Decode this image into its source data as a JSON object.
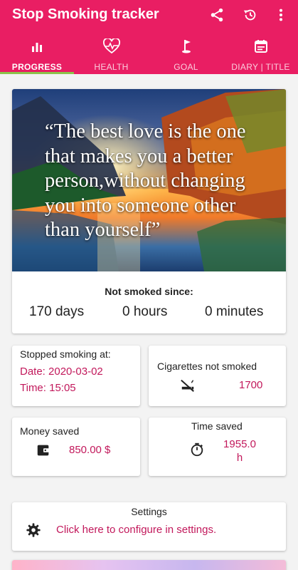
{
  "app": {
    "title": "Stop Smoking tracker"
  },
  "actions": {
    "share_icon": "share-icon",
    "restore_icon": "restore-icon",
    "more_icon": "more-vert-icon"
  },
  "tabs": [
    {
      "label": "PROGRESS",
      "icon": "bar-chart-icon",
      "active": true
    },
    {
      "label": "HEALTH",
      "icon": "heart-pulse-icon",
      "active": false
    },
    {
      "label": "GOAL",
      "icon": "golf-flag-icon",
      "active": false
    },
    {
      "label": "DIARY | TITLE",
      "icon": "calendar-icon",
      "active": false
    }
  ],
  "quote": {
    "lines": [
      "“The best love is the one",
      "that makes you a better",
      "person,without changing",
      "you into someone other",
      "than yourself”"
    ]
  },
  "not_smoked": {
    "title": "Not smoked since:",
    "days": "170 days",
    "hours": "0 hours",
    "minutes": "0 minutes"
  },
  "stopped": {
    "title": "Stopped smoking at:",
    "date": "Date: 2020-03-02",
    "time": "Time: 15:05"
  },
  "cigarettes": {
    "title": "Cigarettes not smoked",
    "value": "1700",
    "icon": "no-smoking-icon"
  },
  "money": {
    "title": "Money saved",
    "value": "850.00 $",
    "icon": "wallet-icon"
  },
  "time_saved": {
    "title": "Time saved",
    "value_line1": "1955.0",
    "value_line2": "h",
    "icon": "stopwatch-icon"
  },
  "settings": {
    "title": "Settings",
    "link": "Click here to configure in settings.",
    "icon": "gear-icon"
  },
  "colors": {
    "primary": "#e91e63",
    "accent": "#c2185b",
    "indicator": "#8bc34a"
  }
}
